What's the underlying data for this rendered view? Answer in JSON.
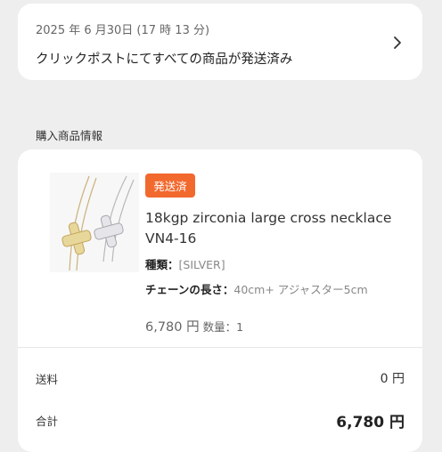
{
  "status": {
    "date": "2025 年 6 月30日 (17 時 13 分)",
    "message": "クリックポストにてすべての商品が発送済み"
  },
  "section_title": "購入商品情報",
  "product": {
    "badge": "発送済",
    "name": "18kgp zirconia large cross necklace VN4-16",
    "attr_type_key": "種類：",
    "attr_type_value": "[SILVER]",
    "attr_length_key": "チェーンの長さ：",
    "attr_length_value": "40cm+ アジャスター5cm",
    "price": "6,780 円",
    "qty": "数量：1"
  },
  "summary": {
    "shipping_label": "送料",
    "shipping_value": "0 円",
    "total_label": "合計",
    "total_value": "6,780 円"
  },
  "colors": {
    "badge": "#f2692e",
    "background": "#eeeeef"
  }
}
